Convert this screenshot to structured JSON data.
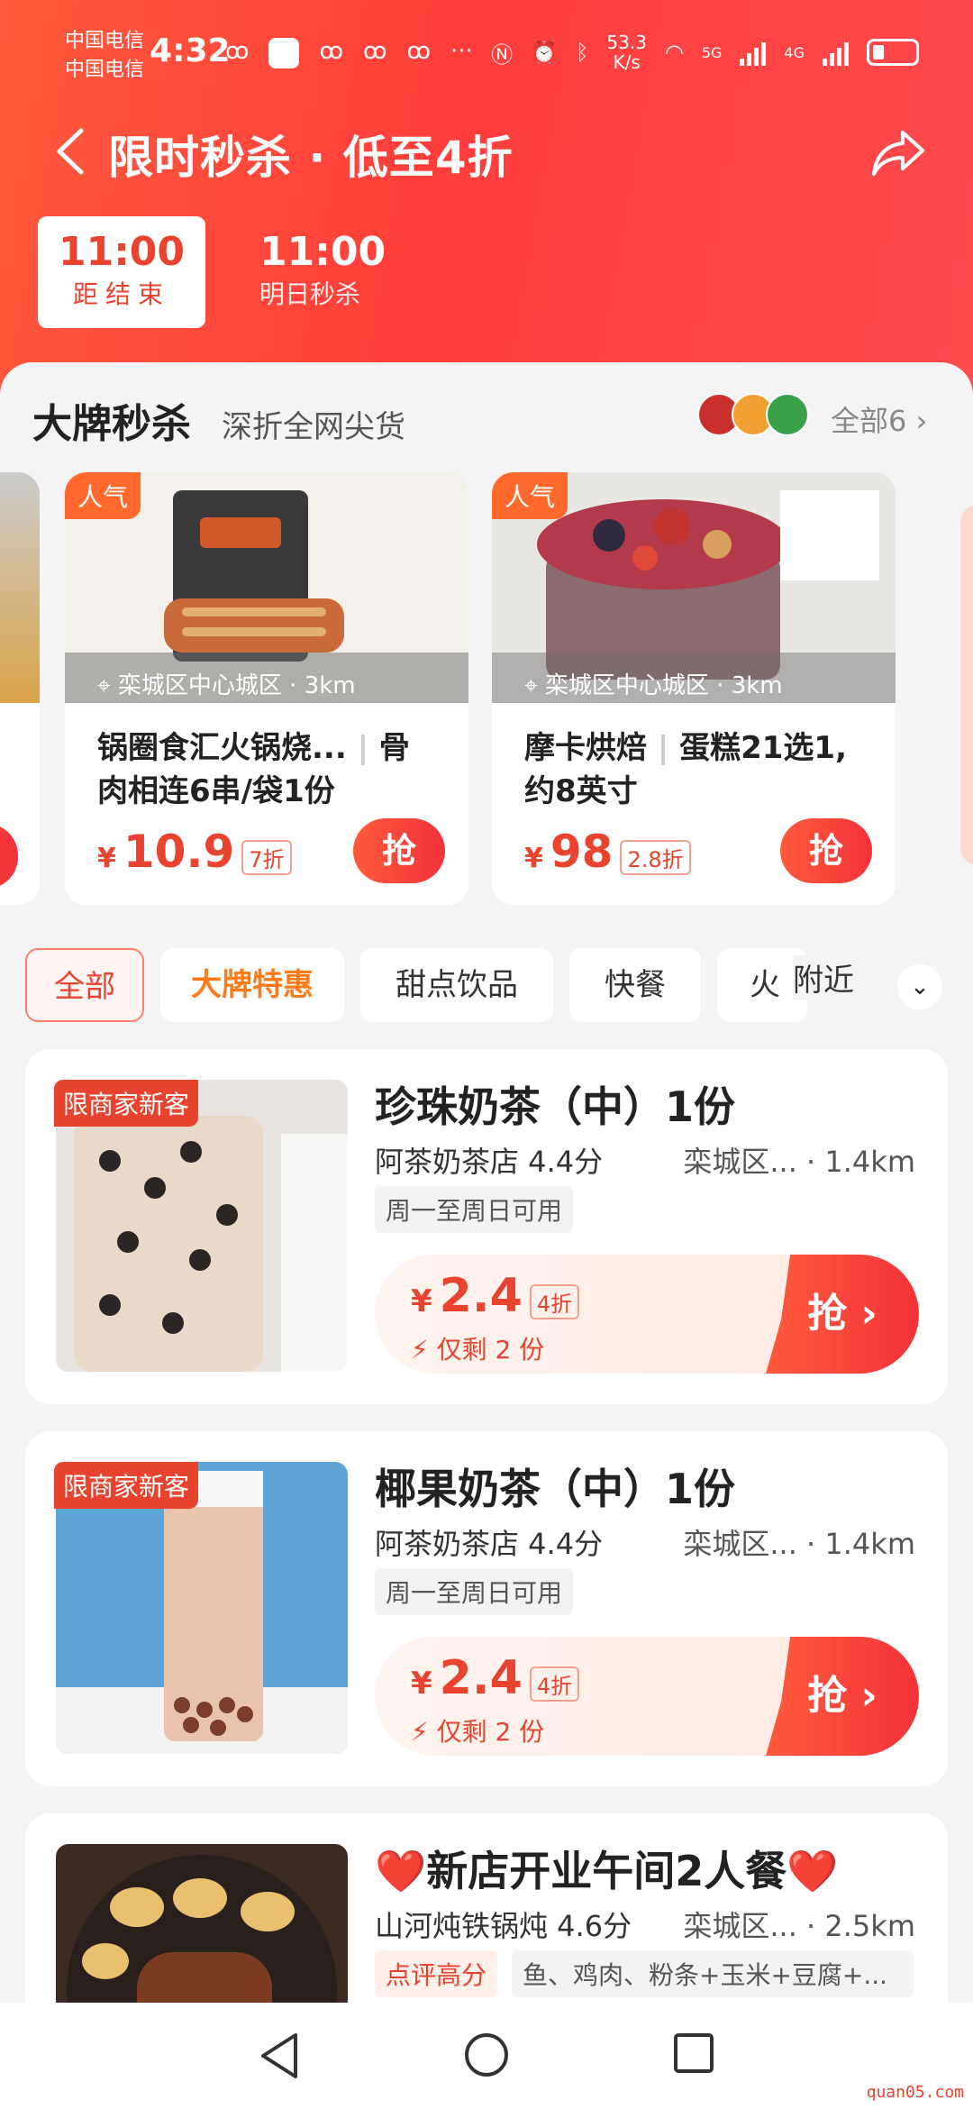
{
  "status_bar": {
    "carrier_1": "中国电信",
    "carrier_2": "中国电信",
    "time": "4:32",
    "net_speed_value": "53.3",
    "net_speed_unit": "K/s",
    "signal_1_label": "5G",
    "signal_2_label": "4G"
  },
  "nav": {
    "title": "限时秒杀 · 低至4折"
  },
  "session_tabs": [
    {
      "time": "11:00",
      "subtitle": "距结束",
      "active": true
    },
    {
      "time": "11:00",
      "subtitle": "明日秒杀",
      "active": false
    }
  ],
  "brand_section": {
    "title": "大牌秒杀",
    "subtitle": "深折全网尖货",
    "all_label": "全部6",
    "cards": [
      {
        "badge": "人气",
        "location": "栾城区中心城区 · 3km",
        "name_part1": "锅圈食汇火锅烧...",
        "name_part2": "骨肉相连6串/袋1份",
        "currency": "¥",
        "price": "10.9",
        "discount": "7折",
        "grab_label": "抢"
      },
      {
        "badge": "人气",
        "location": "栾城区中心城区 · 3km",
        "name_part1": "摩卡烘焙",
        "name_part2": "蛋糕21选1,约8英寸",
        "currency": "¥",
        "price": "98",
        "discount": "2.8折",
        "grab_label": "抢"
      }
    ]
  },
  "categories": [
    {
      "label": "全部",
      "selected": true
    },
    {
      "label": "大牌特惠",
      "selected": false
    },
    {
      "label": "甜点饮品",
      "selected": false
    },
    {
      "label": "快餐",
      "selected": false
    },
    {
      "label": "火锅",
      "selected": false
    }
  ],
  "nearby_label": "附近",
  "deals": [
    {
      "tag": "限商家新客",
      "name": "珍珠奶茶（中）1份",
      "shop": "阿茶奶茶店 4.4分",
      "distance": "栾城区... · 1.4km",
      "usage": "周一至周日可用",
      "currency": "¥",
      "price": "2.4",
      "discount": "4折",
      "stock": "仅剩 2 份",
      "grab_label": "抢 ›"
    },
    {
      "tag": "限商家新客",
      "name": "椰果奶茶（中）1份",
      "shop": "阿茶奶茶店 4.4分",
      "distance": "栾城区... · 1.4km",
      "usage": "周一至周日可用",
      "currency": "¥",
      "price": "2.4",
      "discount": "4折",
      "stock": "仅剩 2 份",
      "grab_label": "抢 ›"
    },
    {
      "tag": "",
      "name": "❤️新店开业午间2人餐❤️",
      "shop": "山河炖铁锅炖 4.6分",
      "distance": "栾城区... · 2.5km",
      "highlight": "点评高分",
      "usage": "鱼、鸡肉、粉条+玉米+豆腐+..."
    }
  ],
  "watermark": "quan05.com",
  "colors": {
    "accent": "#e8432f",
    "brand_orange": "#ff7a19",
    "header_gradient_start": "#ff5a3c",
    "header_gradient_end": "#ff4a4f"
  }
}
